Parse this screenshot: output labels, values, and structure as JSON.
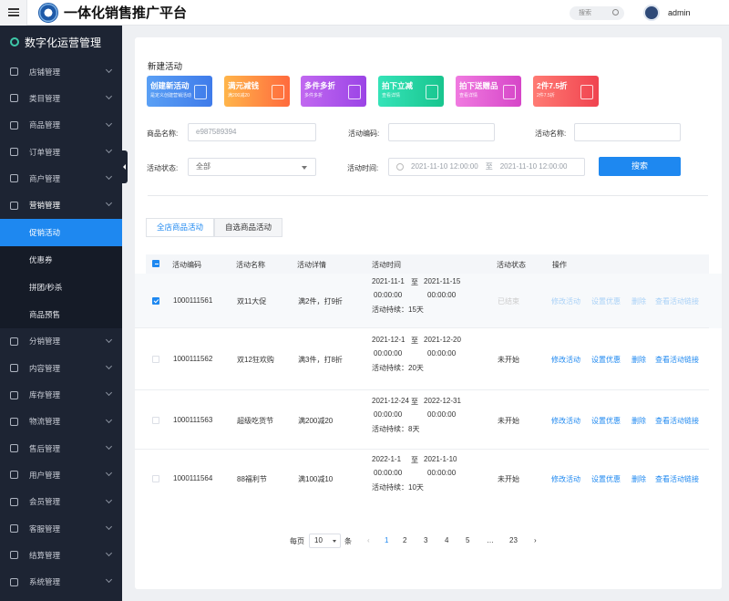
{
  "header": {
    "title": "一体化销售推广平台",
    "search_placeholder": "搜索",
    "user": "admin"
  },
  "sidebar": {
    "title": "数字化运营管理",
    "items": [
      "店铺管理",
      "类目管理",
      "商品管理",
      "订单管理",
      "商户管理",
      "营销管理"
    ],
    "sub_items": [
      "促销活动",
      "优惠券",
      "拼团/秒杀",
      "商品预售"
    ],
    "items_after": [
      "分销管理",
      "内容管理",
      "库存管理",
      "物流管理",
      "售后管理",
      "用户管理",
      "会员管理",
      "客服管理",
      "结算管理",
      "系统管理"
    ]
  },
  "page": {
    "heading": "新建活动",
    "cards": [
      {
        "title": "创建新活动",
        "sub": "是定义创建营销活动",
        "color1": "#5aa0f5",
        "color2": "#3f7bea"
      },
      {
        "title": "满元减钱",
        "sub": "满200减20",
        "color1": "#ffb54a",
        "color2": "#ff6a3d"
      },
      {
        "title": "多件多折",
        "sub": "多件多折",
        "color1": "#c168f0",
        "color2": "#9b44e6"
      },
      {
        "title": "拍下立减",
        "sub": "查看详情",
        "color1": "#35e3b8",
        "color2": "#18c58e"
      },
      {
        "title": "拍下送赠品",
        "sub": "查看详情",
        "color1": "#f07ae0",
        "color2": "#d646c8"
      },
      {
        "title": "2件7.5折",
        "sub": "2件7.5折",
        "color1": "#ff7b74",
        "color2": "#f0434f"
      }
    ],
    "filters": {
      "product_label": "商品名称:",
      "product_value": "e987589394",
      "code_label": "活动编码:",
      "name_label": "活动名称:",
      "status_label": "活动状态:",
      "status_value": "全部",
      "time_label": "活动时间:",
      "time_start": "2021-11-10 12:00:00",
      "time_sep": "至",
      "time_end": "2021-11-10 12:00:00",
      "search_button": "搜索"
    },
    "tabs": [
      "全店商品活动",
      "自选商品活动"
    ],
    "columns": [
      "活动编码",
      "活动名称",
      "活动详情",
      "活动时间",
      "活动状态",
      "操作"
    ],
    "rows": [
      {
        "code": "1000111561",
        "name": "双11大促",
        "detail": "满2件，打9折",
        "start": "2021-11-1",
        "sep": "至",
        "end": "2021-11-15",
        "t1": "00:00:00",
        "t2": "00:00:00",
        "duration": "活动持续：15天",
        "status": "已结束",
        "checked": true
      },
      {
        "code": "1000111562",
        "name": "双12狂欢购",
        "detail": "满3件，打8折",
        "start": "2021-12-1",
        "sep": "至",
        "end": "2021-12-20",
        "t1": "00:00:00",
        "t2": "00:00:00",
        "duration": "活动持续：20天",
        "status": "未开始",
        "checked": false
      },
      {
        "code": "1000111563",
        "name": "超级吃货节",
        "detail": "满200减20",
        "start": "2021-12-24",
        "sep": "至",
        "end": "2022-12-31",
        "t1": "00:00:00",
        "t2": "00:00:00",
        "duration": "活动持续：8天",
        "status": "未开始",
        "checked": false
      },
      {
        "code": "1000111564",
        "name": "88福利节",
        "detail": "满100减10",
        "start": "2022-1-1",
        "sep": "至",
        "end": "2021-1-10",
        "t1": "00:00:00",
        "t2": "00:00:00",
        "duration": "活动持续：10天",
        "status": "未开始",
        "checked": false
      }
    ],
    "actions": [
      "修改活动",
      "设置优惠",
      "删除",
      "查看活动链接"
    ],
    "pagination": {
      "per_page_label": "每页",
      "per_page_value": "10",
      "unit": "条",
      "pages": [
        "1",
        "2",
        "3",
        "4",
        "5",
        "…",
        "23"
      ],
      "current": "1"
    }
  }
}
